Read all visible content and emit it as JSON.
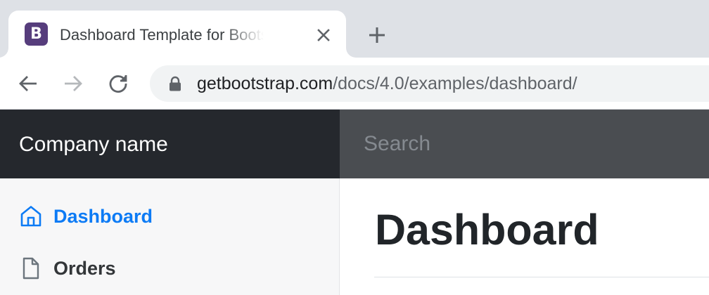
{
  "browser": {
    "tab": {
      "favicon_letter": "B",
      "title": "Dashboard Template for Bootstrap",
      "close_icon": "close-icon",
      "favicon_color": "#563d7c"
    },
    "new_tab_icon": "plus-icon",
    "toolbar": {
      "back_icon": "arrow-left-icon",
      "forward_icon": "arrow-right-icon",
      "reload_icon": "reload-icon",
      "lock_icon": "lock-icon",
      "url_host": "getbootstrap.com",
      "url_path": "/docs/4.0/examples/dashboard/"
    }
  },
  "page": {
    "navbar": {
      "brand": "Company name",
      "search_placeholder": "Search"
    },
    "sidebar": {
      "items": [
        {
          "label": "Dashboard",
          "icon": "home-icon",
          "active": true
        },
        {
          "label": "Orders",
          "icon": "file-icon",
          "active": false
        }
      ]
    },
    "main": {
      "title": "Dashboard"
    }
  },
  "colors": {
    "tabstrip_bg": "#dee1e6",
    "navbar_dark": "#25282d",
    "search_bg": "#4a4d51",
    "sidebar_bg": "#f7f7f8",
    "active_link": "#0d7bf5",
    "text_dark": "#212529"
  }
}
